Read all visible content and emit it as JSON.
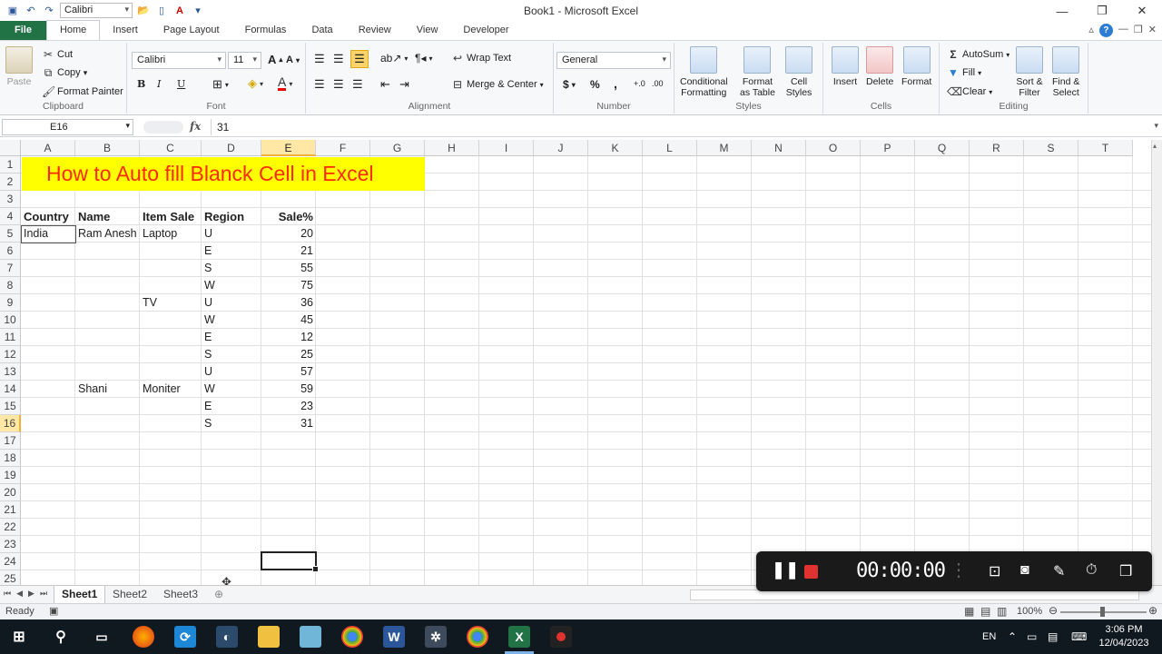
{
  "window": {
    "title": "Book1  -  Microsoft Excel",
    "qat_font": "Calibri"
  },
  "tabs": [
    "File",
    "Home",
    "Insert",
    "Page Layout",
    "Formulas",
    "Data",
    "Review",
    "View",
    "Developer"
  ],
  "ribbon": {
    "clipboard": {
      "name": "Clipboard",
      "paste": "Paste",
      "cut": "Cut",
      "copy": "Copy",
      "format_painter": "Format Painter"
    },
    "font": {
      "name": "Font",
      "font_family": "Calibri",
      "font_size": "11",
      "bold": "B",
      "italic": "I",
      "underline": "U"
    },
    "alignment": {
      "name": "Alignment",
      "wrap_text": "Wrap Text",
      "merge_center": "Merge & Center"
    },
    "number": {
      "name": "Number",
      "format": "General",
      "currency": "$",
      "percent": "%",
      "comma": ","
    },
    "styles": {
      "name": "Styles",
      "conditional_1": "Conditional",
      "conditional_2": "Formatting",
      "format_table_1": "Format",
      "format_table_2": "as Table",
      "cell_styles_1": "Cell",
      "cell_styles_2": "Styles"
    },
    "cells": {
      "name": "Cells",
      "insert": "Insert",
      "delete": "Delete",
      "format": "Format"
    },
    "editing": {
      "name": "Editing",
      "autosum": "AutoSum",
      "fill": "Fill",
      "clear": "Clear",
      "sort_1": "Sort &",
      "sort_2": "Filter",
      "find_1": "Find &",
      "find_2": "Select"
    }
  },
  "formula_bar": {
    "name_box": "E16",
    "fx": "fx",
    "value": "31"
  },
  "columns": [
    "A",
    "B",
    "C",
    "D",
    "E",
    "F",
    "G",
    "H",
    "I",
    "J",
    "K",
    "L",
    "M",
    "N",
    "O",
    "P",
    "Q",
    "R",
    "S",
    "T"
  ],
  "rows": [
    "1",
    "2",
    "3",
    "4",
    "5",
    "6",
    "7",
    "8",
    "9",
    "10",
    "11",
    "12",
    "13",
    "14",
    "15",
    "16",
    "17",
    "18",
    "19",
    "20",
    "21",
    "22",
    "23",
    "24",
    "25"
  ],
  "banner": "How to Auto fill Blanck Cell in Excel",
  "headers": [
    "Country",
    "Name",
    "Item Sale",
    "Region",
    "Sale%"
  ],
  "data_rows": [
    {
      "row": 5,
      "country": "India",
      "name": "Ram Anesh",
      "item": "Laptop",
      "region": "U",
      "sale": "20"
    },
    {
      "row": 6,
      "country": "",
      "name": "",
      "item": "",
      "region": "E",
      "sale": "21"
    },
    {
      "row": 7,
      "country": "",
      "name": "",
      "item": "",
      "region": "S",
      "sale": "55"
    },
    {
      "row": 8,
      "country": "",
      "name": "",
      "item": "",
      "region": "W",
      "sale": "75"
    },
    {
      "row": 9,
      "country": "",
      "name": "",
      "item": "TV",
      "region": "U",
      "sale": "36"
    },
    {
      "row": 10,
      "country": "",
      "name": "",
      "item": "",
      "region": "W",
      "sale": "45"
    },
    {
      "row": 11,
      "country": "",
      "name": "",
      "item": "",
      "region": "E",
      "sale": "12"
    },
    {
      "row": 12,
      "country": "",
      "name": "",
      "item": "",
      "region": "S",
      "sale": "25"
    },
    {
      "row": 13,
      "country": "",
      "name": "",
      "item": "",
      "region": "U",
      "sale": "57"
    },
    {
      "row": 14,
      "country": "",
      "name": "Shani",
      "item": "Moniter",
      "region": "W",
      "sale": "59"
    },
    {
      "row": 15,
      "country": "",
      "name": "",
      "item": "",
      "region": "E",
      "sale": "23"
    },
    {
      "row": 16,
      "country": "",
      "name": "",
      "item": "",
      "region": "S",
      "sale": "31"
    }
  ],
  "sheets": [
    "Sheet1",
    "Sheet2",
    "Sheet3"
  ],
  "status": {
    "ready": "Ready",
    "zoom": "100%"
  },
  "recorder": {
    "time": "00:00:00"
  },
  "taskbar": {
    "lang": "EN",
    "time": "3:06 PM",
    "date": "12/04/2023"
  }
}
